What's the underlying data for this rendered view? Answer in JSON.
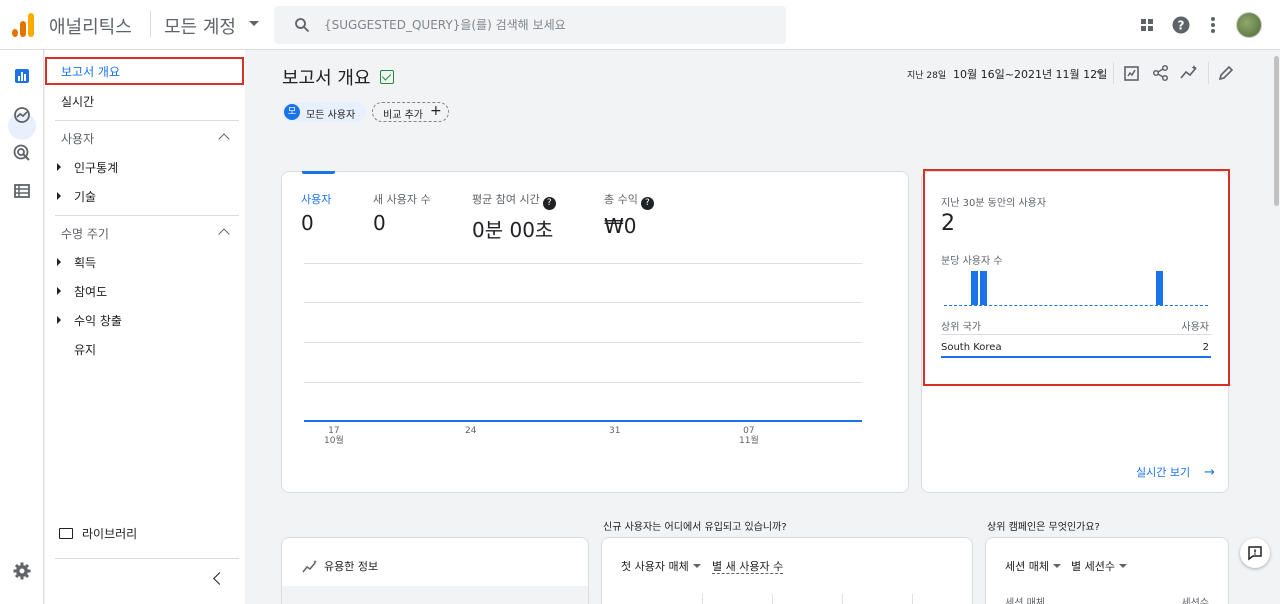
{
  "app": {
    "title": "애널리틱스",
    "account": "모든 계정"
  },
  "search": {
    "placeholder": "{SUGGESTED_QUERY}을(를) 검색해 보세요"
  },
  "sidebar": {
    "items": [
      {
        "label": "보고서 개요"
      },
      {
        "label": "실시간"
      }
    ],
    "sections": [
      {
        "label": "사용자",
        "children": [
          "인구통계",
          "기술"
        ]
      },
      {
        "label": "수명 주기",
        "children": [
          "획득",
          "참여도",
          "수익 창출",
          "유지"
        ]
      }
    ],
    "library": "라이브러리"
  },
  "header": {
    "title": "보고서 개요",
    "chip_all_initial": "모",
    "chip_all": "모든 사용자",
    "chip_compare": "비교 추가",
    "date_prefix": "지난 28일",
    "date_range": "10월 16일~2021년 11월 12일"
  },
  "metrics": [
    {
      "label": "사용자",
      "value": "0"
    },
    {
      "label": "새 사용자 수",
      "value": "0"
    },
    {
      "label": "평균 참여 시간",
      "value": "0분 00초"
    },
    {
      "label": "총 수익",
      "value": "₩0"
    }
  ],
  "chart_data": {
    "type": "line",
    "x": [
      "17",
      "24",
      "31",
      "07"
    ],
    "x_sublabels": [
      "10월",
      "",
      "",
      "11월"
    ],
    "series": [
      {
        "values": [
          0,
          0,
          0,
          0
        ]
      }
    ]
  },
  "realtime": {
    "label": "지난 30분 동안의 사용자",
    "value": "2",
    "sub": "분당 사용자 수",
    "bars": [
      0,
      0,
      0,
      2,
      2,
      0,
      0,
      0,
      0,
      0,
      0,
      0,
      0,
      0,
      0,
      0,
      0,
      0,
      0,
      0,
      0,
      0,
      0,
      0,
      2,
      0,
      0,
      0,
      0,
      0
    ],
    "table_header_country": "상위 국가",
    "table_header_users": "사용자",
    "rows": [
      {
        "country": "South Korea",
        "users": "2"
      }
    ],
    "link": "실시간 보기"
  },
  "section2": {
    "q1": "신규 사용자는 어디에서 유입되고 있습니까?",
    "q2": "상위 캠페인은 무엇인가요?",
    "insight": "유용한 정보",
    "src_dd1": "첫 사용자 매체",
    "src_dd2": "별 새 사용자 수",
    "camp_dd1": "세션 매체",
    "camp_dd2": "별 세션수",
    "camp_col1": "세션 매체",
    "camp_col2": "세션수"
  },
  "colors": {
    "accent": "#1a73e8",
    "highlight": "#d93025"
  }
}
